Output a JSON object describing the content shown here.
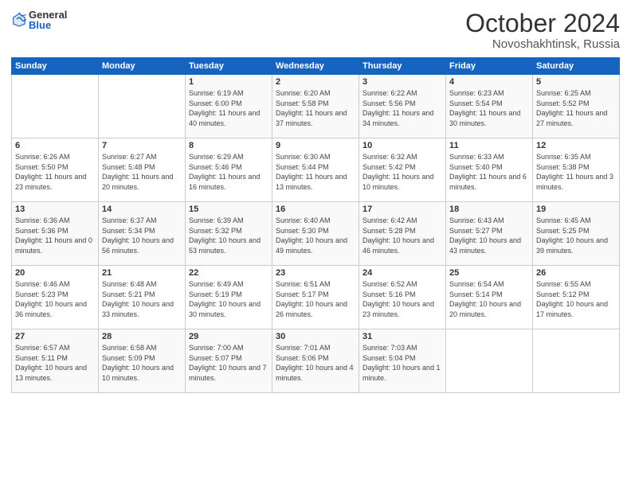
{
  "logo": {
    "general": "General",
    "blue": "Blue"
  },
  "title": "October 2024",
  "location": "Novoshakhtinsk, Russia",
  "headers": [
    "Sunday",
    "Monday",
    "Tuesday",
    "Wednesday",
    "Thursday",
    "Friday",
    "Saturday"
  ],
  "weeks": [
    [
      {
        "day": "",
        "sunrise": "",
        "sunset": "",
        "daylight": ""
      },
      {
        "day": "",
        "sunrise": "",
        "sunset": "",
        "daylight": ""
      },
      {
        "day": "1",
        "sunrise": "Sunrise: 6:19 AM",
        "sunset": "Sunset: 6:00 PM",
        "daylight": "Daylight: 11 hours and 40 minutes."
      },
      {
        "day": "2",
        "sunrise": "Sunrise: 6:20 AM",
        "sunset": "Sunset: 5:58 PM",
        "daylight": "Daylight: 11 hours and 37 minutes."
      },
      {
        "day": "3",
        "sunrise": "Sunrise: 6:22 AM",
        "sunset": "Sunset: 5:56 PM",
        "daylight": "Daylight: 11 hours and 34 minutes."
      },
      {
        "day": "4",
        "sunrise": "Sunrise: 6:23 AM",
        "sunset": "Sunset: 5:54 PM",
        "daylight": "Daylight: 11 hours and 30 minutes."
      },
      {
        "day": "5",
        "sunrise": "Sunrise: 6:25 AM",
        "sunset": "Sunset: 5:52 PM",
        "daylight": "Daylight: 11 hours and 27 minutes."
      }
    ],
    [
      {
        "day": "6",
        "sunrise": "Sunrise: 6:26 AM",
        "sunset": "Sunset: 5:50 PM",
        "daylight": "Daylight: 11 hours and 23 minutes."
      },
      {
        "day": "7",
        "sunrise": "Sunrise: 6:27 AM",
        "sunset": "Sunset: 5:48 PM",
        "daylight": "Daylight: 11 hours and 20 minutes."
      },
      {
        "day": "8",
        "sunrise": "Sunrise: 6:29 AM",
        "sunset": "Sunset: 5:46 PM",
        "daylight": "Daylight: 11 hours and 16 minutes."
      },
      {
        "day": "9",
        "sunrise": "Sunrise: 6:30 AM",
        "sunset": "Sunset: 5:44 PM",
        "daylight": "Daylight: 11 hours and 13 minutes."
      },
      {
        "day": "10",
        "sunrise": "Sunrise: 6:32 AM",
        "sunset": "Sunset: 5:42 PM",
        "daylight": "Daylight: 11 hours and 10 minutes."
      },
      {
        "day": "11",
        "sunrise": "Sunrise: 6:33 AM",
        "sunset": "Sunset: 5:40 PM",
        "daylight": "Daylight: 11 hours and 6 minutes."
      },
      {
        "day": "12",
        "sunrise": "Sunrise: 6:35 AM",
        "sunset": "Sunset: 5:38 PM",
        "daylight": "Daylight: 11 hours and 3 minutes."
      }
    ],
    [
      {
        "day": "13",
        "sunrise": "Sunrise: 6:36 AM",
        "sunset": "Sunset: 5:36 PM",
        "daylight": "Daylight: 11 hours and 0 minutes."
      },
      {
        "day": "14",
        "sunrise": "Sunrise: 6:37 AM",
        "sunset": "Sunset: 5:34 PM",
        "daylight": "Daylight: 10 hours and 56 minutes."
      },
      {
        "day": "15",
        "sunrise": "Sunrise: 6:39 AM",
        "sunset": "Sunset: 5:32 PM",
        "daylight": "Daylight: 10 hours and 53 minutes."
      },
      {
        "day": "16",
        "sunrise": "Sunrise: 6:40 AM",
        "sunset": "Sunset: 5:30 PM",
        "daylight": "Daylight: 10 hours and 49 minutes."
      },
      {
        "day": "17",
        "sunrise": "Sunrise: 6:42 AM",
        "sunset": "Sunset: 5:28 PM",
        "daylight": "Daylight: 10 hours and 46 minutes."
      },
      {
        "day": "18",
        "sunrise": "Sunrise: 6:43 AM",
        "sunset": "Sunset: 5:27 PM",
        "daylight": "Daylight: 10 hours and 43 minutes."
      },
      {
        "day": "19",
        "sunrise": "Sunrise: 6:45 AM",
        "sunset": "Sunset: 5:25 PM",
        "daylight": "Daylight: 10 hours and 39 minutes."
      }
    ],
    [
      {
        "day": "20",
        "sunrise": "Sunrise: 6:46 AM",
        "sunset": "Sunset: 5:23 PM",
        "daylight": "Daylight: 10 hours and 36 minutes."
      },
      {
        "day": "21",
        "sunrise": "Sunrise: 6:48 AM",
        "sunset": "Sunset: 5:21 PM",
        "daylight": "Daylight: 10 hours and 33 minutes."
      },
      {
        "day": "22",
        "sunrise": "Sunrise: 6:49 AM",
        "sunset": "Sunset: 5:19 PM",
        "daylight": "Daylight: 10 hours and 30 minutes."
      },
      {
        "day": "23",
        "sunrise": "Sunrise: 6:51 AM",
        "sunset": "Sunset: 5:17 PM",
        "daylight": "Daylight: 10 hours and 26 minutes."
      },
      {
        "day": "24",
        "sunrise": "Sunrise: 6:52 AM",
        "sunset": "Sunset: 5:16 PM",
        "daylight": "Daylight: 10 hours and 23 minutes."
      },
      {
        "day": "25",
        "sunrise": "Sunrise: 6:54 AM",
        "sunset": "Sunset: 5:14 PM",
        "daylight": "Daylight: 10 hours and 20 minutes."
      },
      {
        "day": "26",
        "sunrise": "Sunrise: 6:55 AM",
        "sunset": "Sunset: 5:12 PM",
        "daylight": "Daylight: 10 hours and 17 minutes."
      }
    ],
    [
      {
        "day": "27",
        "sunrise": "Sunrise: 6:57 AM",
        "sunset": "Sunset: 5:11 PM",
        "daylight": "Daylight: 10 hours and 13 minutes."
      },
      {
        "day": "28",
        "sunrise": "Sunrise: 6:58 AM",
        "sunset": "Sunset: 5:09 PM",
        "daylight": "Daylight: 10 hours and 10 minutes."
      },
      {
        "day": "29",
        "sunrise": "Sunrise: 7:00 AM",
        "sunset": "Sunset: 5:07 PM",
        "daylight": "Daylight: 10 hours and 7 minutes."
      },
      {
        "day": "30",
        "sunrise": "Sunrise: 7:01 AM",
        "sunset": "Sunset: 5:06 PM",
        "daylight": "Daylight: 10 hours and 4 minutes."
      },
      {
        "day": "31",
        "sunrise": "Sunrise: 7:03 AM",
        "sunset": "Sunset: 5:04 PM",
        "daylight": "Daylight: 10 hours and 1 minute."
      },
      {
        "day": "",
        "sunrise": "",
        "sunset": "",
        "daylight": ""
      },
      {
        "day": "",
        "sunrise": "",
        "sunset": "",
        "daylight": ""
      }
    ]
  ]
}
